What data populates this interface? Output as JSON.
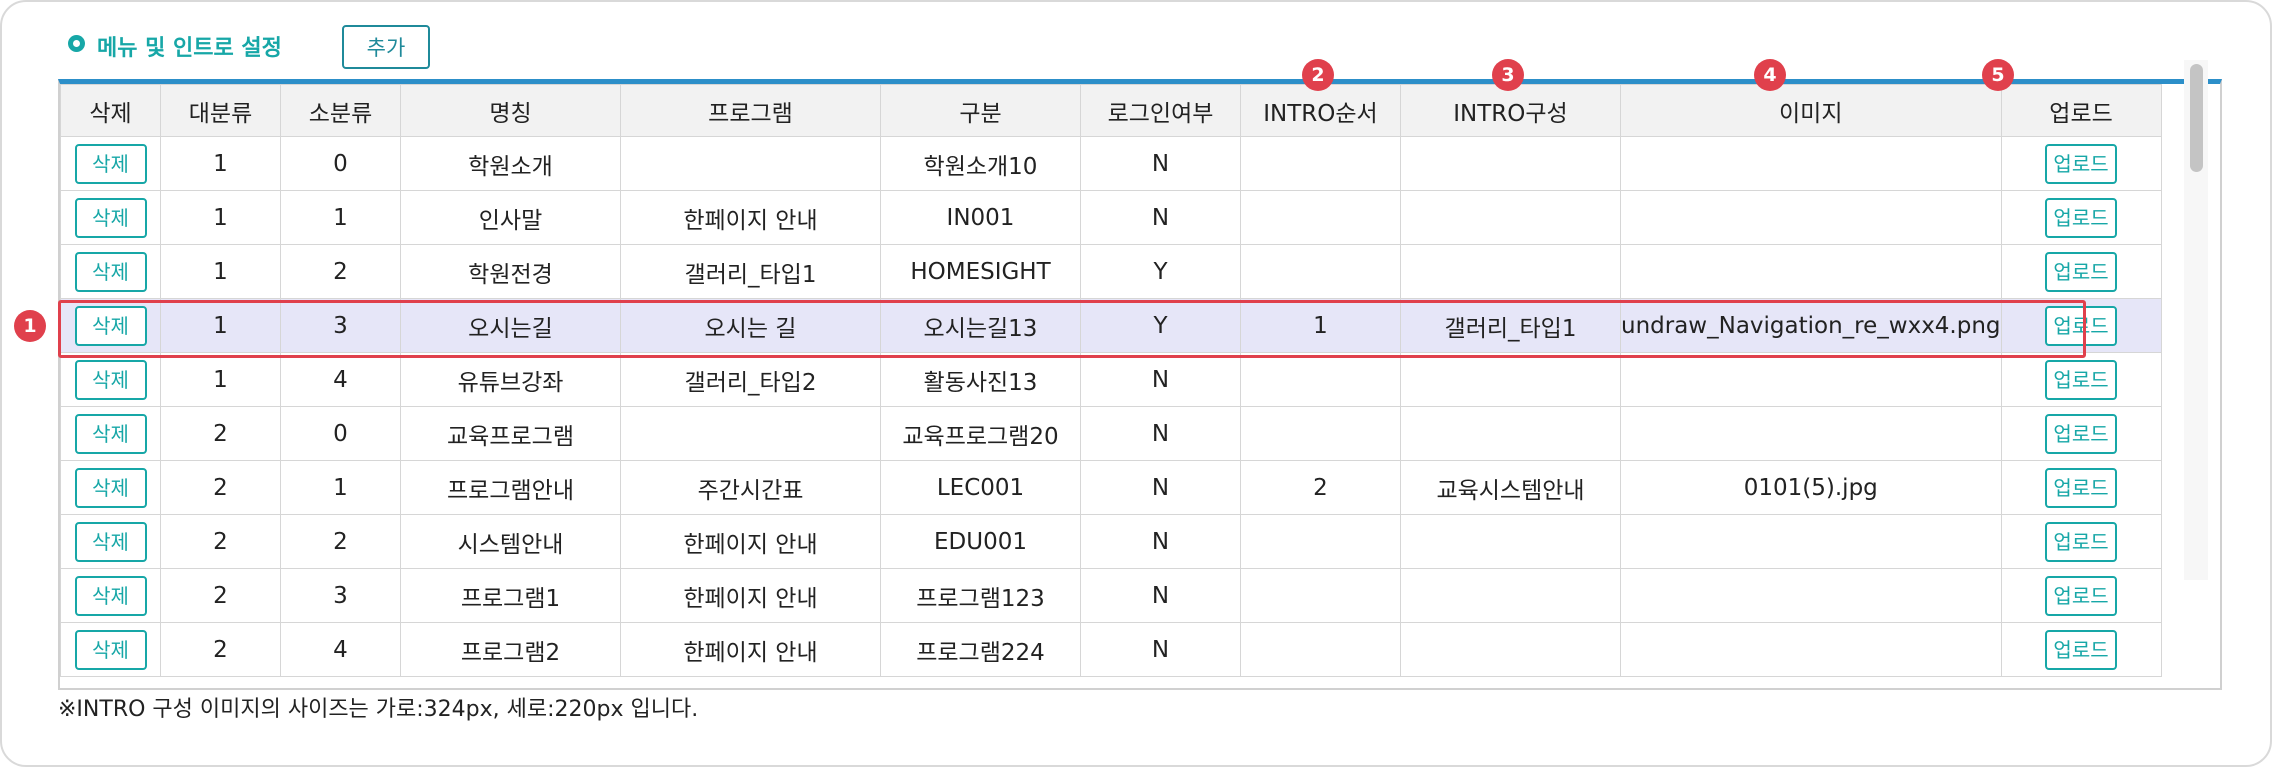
{
  "section_title": "메뉴 및 인트로 설정",
  "add_button": "추가",
  "columns": [
    "삭제",
    "대분류",
    "소분류",
    "명칭",
    "프로그램",
    "구분",
    "로그인여부",
    "INTRO순서",
    "INTRO구성",
    "이미지",
    "업로드"
  ],
  "delete_label": "삭제",
  "upload_label": "업로드",
  "rows": [
    {
      "major": "1",
      "minor": "0",
      "name": "학원소개",
      "program": "",
      "type": "학원소개10",
      "login": "N",
      "intro_order": "",
      "intro_config": "",
      "image": ""
    },
    {
      "major": "1",
      "minor": "1",
      "name": "인사말",
      "program": "한페이지 안내",
      "type": "IN001",
      "login": "N",
      "intro_order": "",
      "intro_config": "",
      "image": ""
    },
    {
      "major": "1",
      "minor": "2",
      "name": "학원전경",
      "program": "갤러리_타입1",
      "type": "HOMESIGHT",
      "login": "Y",
      "intro_order": "",
      "intro_config": "",
      "image": ""
    },
    {
      "major": "1",
      "minor": "3",
      "name": "오시는길",
      "program": "오시는 길",
      "type": "오시는길13",
      "login": "Y",
      "intro_order": "1",
      "intro_config": "갤러리_타입1",
      "image": "undraw_Navigation_re_wxx4.png"
    },
    {
      "major": "1",
      "minor": "4",
      "name": "유튜브강좌",
      "program": "갤러리_타입2",
      "type": "활동사진13",
      "login": "N",
      "intro_order": "",
      "intro_config": "",
      "image": ""
    },
    {
      "major": "2",
      "minor": "0",
      "name": "교육프로그램",
      "program": "",
      "type": "교육프로그램20",
      "login": "N",
      "intro_order": "",
      "intro_config": "",
      "image": ""
    },
    {
      "major": "2",
      "minor": "1",
      "name": "프로그램안내",
      "program": "주간시간표",
      "type": "LEC001",
      "login": "N",
      "intro_order": "2",
      "intro_config": "교육시스템안내",
      "image": "0101(5).jpg"
    },
    {
      "major": "2",
      "minor": "2",
      "name": "시스템안내",
      "program": "한페이지 안내",
      "type": "EDU001",
      "login": "N",
      "intro_order": "",
      "intro_config": "",
      "image": ""
    },
    {
      "major": "2",
      "minor": "3",
      "name": "프로그램1",
      "program": "한페이지 안내",
      "type": "프로그램123",
      "login": "N",
      "intro_order": "",
      "intro_config": "",
      "image": ""
    },
    {
      "major": "2",
      "minor": "4",
      "name": "프로그램2",
      "program": "한페이지 안내",
      "type": "프로그램224",
      "login": "N",
      "intro_order": "",
      "intro_config": "",
      "image": ""
    }
  ],
  "highlighted_row_index": 3,
  "markers": [
    "1",
    "2",
    "3",
    "4",
    "5"
  ],
  "note": "※INTRO 구성 이미지의 사이즈는 가로:324px, 세로:220px 입니다.",
  "colors": {
    "accent": "#17a7a7",
    "table_top_border": "#2c8fc9",
    "marker": "#e0404c",
    "highlight_row": "#e6e6f8"
  }
}
